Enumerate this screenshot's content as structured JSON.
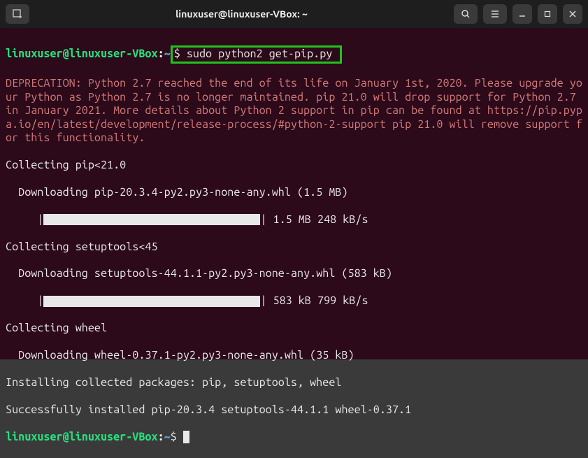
{
  "titlebar": {
    "title": "linuxuser@linuxuser-VBox: ~"
  },
  "prompt": {
    "user_host": "linuxuser@linuxuser-VBox",
    "path": "~",
    "dollar": "$"
  },
  "command": " sudo python2 get-pip.py ",
  "output": {
    "deprecation": "DEPRECATION: Python 2.7 reached the end of its life on January 1st, 2020. Please upgrade your Python as Python 2.7 is no longer maintained. pip 21.0 will drop support for Python 2.7 in January 2021. More details about Python 2 support in pip can be found at https://pip.pypa.io/en/latest/development/release-process/#python-2-support pip 21.0 will remove support for this functionality.",
    "collect_pip": "Collecting pip<21.0",
    "download_pip": "  Downloading pip-20.3.4-py2.py3-none-any.whl (1.5 MB)",
    "progress_pip_stats": " 1.5 MB 248 kB/s",
    "collect_setuptools": "Collecting setuptools<45",
    "download_setuptools": "  Downloading setuptools-44.1.1-py2.py3-none-any.whl (583 kB)",
    "progress_setuptools_stats": " 583 kB 799 kB/s",
    "collect_wheel": "Collecting wheel",
    "download_wheel": "  Downloading wheel-0.37.1-py2.py3-none-any.whl (35 kB)",
    "installing": "Installing collected packages: pip, setuptools, wheel",
    "success": "Successfully installed pip-20.3.4 setuptools-44.1.1 wheel-0.37.1"
  }
}
